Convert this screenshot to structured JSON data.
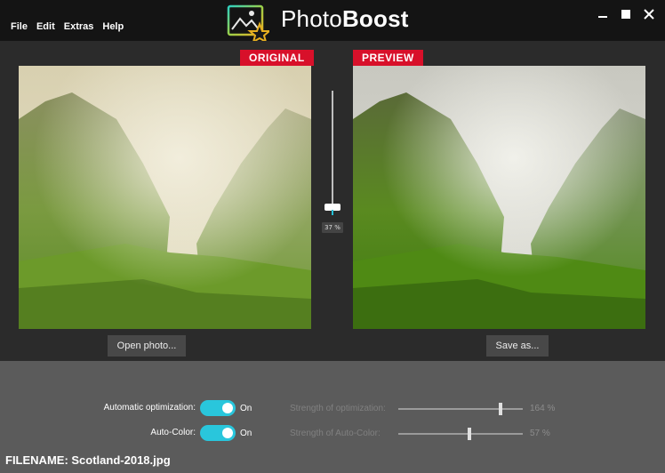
{
  "app": {
    "brand_light": "Photo",
    "brand_bold": "Boost"
  },
  "menu": [
    "File",
    "Edit",
    "Extras",
    "Help"
  ],
  "window_controls": {
    "minimize_icon": "minimize-icon",
    "maximize_icon": "maximize-icon",
    "close_icon": "close-icon"
  },
  "labels": {
    "original": "ORIGINAL",
    "preview": "PREVIEW"
  },
  "compare_slider": {
    "value_label": "37 %",
    "value": 37
  },
  "buttons": {
    "open": "Open photo...",
    "save": "Save as..."
  },
  "options": [
    {
      "label": "Automatic optimization:",
      "state": "On",
      "strength_label": "Strength of optimization:",
      "strength_text": "164 %",
      "strength_fraction": 0.82
    },
    {
      "label": "Auto-Color:",
      "state": "On",
      "strength_label": "Strength of Auto-Color:",
      "strength_text": "57 %",
      "strength_fraction": 0.57
    }
  ],
  "footer": {
    "filename": "FILENAME: Scotland-2018.jpg"
  },
  "colors": {
    "accent": "#29c6dc",
    "tag": "#d8102a",
    "panel": "#5b5b5b"
  }
}
